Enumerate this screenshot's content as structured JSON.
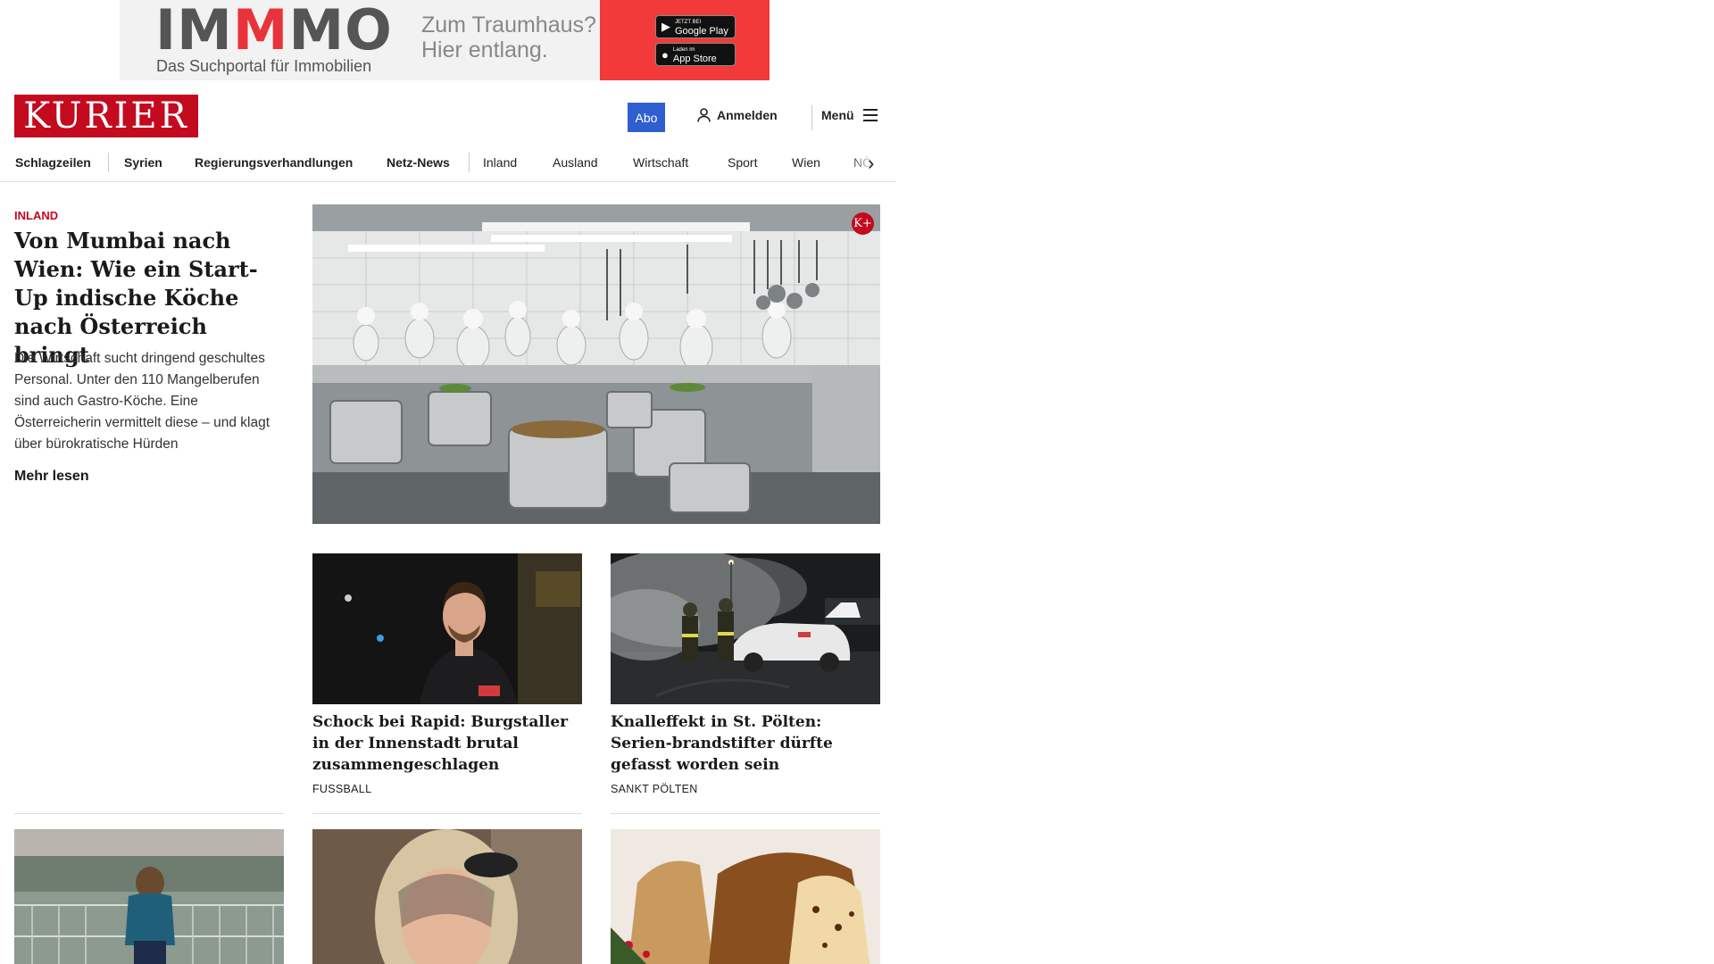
{
  "ad": {
    "logo_parts": [
      "IM",
      "M",
      "MO"
    ],
    "subtitle": "Das Suchportal für Immobilien",
    "slogan_line1": "Zum Traumhaus?",
    "slogan_line2": "Hier entlang.",
    "google_play": "Google Play",
    "google_play_top": "JETZT BEI",
    "app_store": "App Store",
    "app_store_top": "Laden im",
    "colors": {
      "accent": "#e8333a",
      "panel": "#f23a3a"
    }
  },
  "header": {
    "logo": "KURIER",
    "abo": "Abo",
    "login": "Anmelden",
    "menu": "Menü",
    "colors": {
      "brand": "#c30a1e",
      "abo": "#2f5fcf"
    }
  },
  "nav": {
    "items": [
      "Schlagzeilen",
      "Syrien",
      "Regierungsverhandlungen",
      "Netz-News",
      "Inland",
      "Ausland",
      "Wirtschaft",
      "Sport",
      "Wien",
      "NÖ"
    ]
  },
  "lead": {
    "category": "INLAND",
    "title": "Von Mumbai nach Wien: Wie ein Start-Up indische Köche nach Österreich bringt",
    "teaser": "Die Wirtschaft sucht dringend geschultes Personal. Unter den 110 Mangelberufen sind auch Gastro-Köche. Eine Österreicherin vermittelt diese – und klagt über bürokratische Hürden",
    "more": "Mehr lesen",
    "badge": "K+"
  },
  "cards": [
    {
      "title": "Schock bei Rapid: Burgstaller in der Innenstadt brutal zusammengeschlagen",
      "category": "FUSSBALL"
    },
    {
      "title": "Knalleffekt in St. Pölten: Serien-brandstifter dürfte gefasst worden sein",
      "category": "SANKT PÖLTEN"
    }
  ]
}
